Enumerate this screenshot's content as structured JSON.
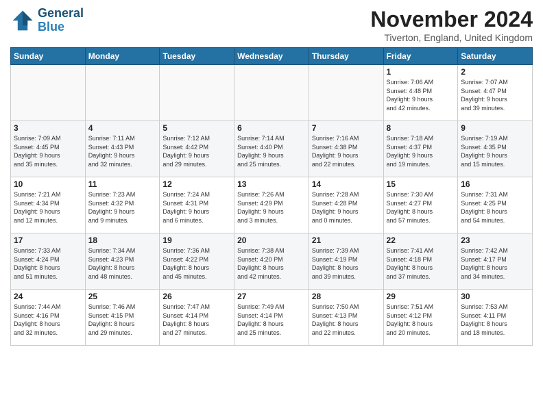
{
  "header": {
    "logo_line1": "General",
    "logo_line2": "Blue",
    "month": "November 2024",
    "location": "Tiverton, England, United Kingdom"
  },
  "weekdays": [
    "Sunday",
    "Monday",
    "Tuesday",
    "Wednesday",
    "Thursday",
    "Friday",
    "Saturday"
  ],
  "weeks": [
    [
      {
        "day": "",
        "info": ""
      },
      {
        "day": "",
        "info": ""
      },
      {
        "day": "",
        "info": ""
      },
      {
        "day": "",
        "info": ""
      },
      {
        "day": "",
        "info": ""
      },
      {
        "day": "1",
        "info": "Sunrise: 7:06 AM\nSunset: 4:48 PM\nDaylight: 9 hours\nand 42 minutes."
      },
      {
        "day": "2",
        "info": "Sunrise: 7:07 AM\nSunset: 4:47 PM\nDaylight: 9 hours\nand 39 minutes."
      }
    ],
    [
      {
        "day": "3",
        "info": "Sunrise: 7:09 AM\nSunset: 4:45 PM\nDaylight: 9 hours\nand 35 minutes."
      },
      {
        "day": "4",
        "info": "Sunrise: 7:11 AM\nSunset: 4:43 PM\nDaylight: 9 hours\nand 32 minutes."
      },
      {
        "day": "5",
        "info": "Sunrise: 7:12 AM\nSunset: 4:42 PM\nDaylight: 9 hours\nand 29 minutes."
      },
      {
        "day": "6",
        "info": "Sunrise: 7:14 AM\nSunset: 4:40 PM\nDaylight: 9 hours\nand 25 minutes."
      },
      {
        "day": "7",
        "info": "Sunrise: 7:16 AM\nSunset: 4:38 PM\nDaylight: 9 hours\nand 22 minutes."
      },
      {
        "day": "8",
        "info": "Sunrise: 7:18 AM\nSunset: 4:37 PM\nDaylight: 9 hours\nand 19 minutes."
      },
      {
        "day": "9",
        "info": "Sunrise: 7:19 AM\nSunset: 4:35 PM\nDaylight: 9 hours\nand 15 minutes."
      }
    ],
    [
      {
        "day": "10",
        "info": "Sunrise: 7:21 AM\nSunset: 4:34 PM\nDaylight: 9 hours\nand 12 minutes."
      },
      {
        "day": "11",
        "info": "Sunrise: 7:23 AM\nSunset: 4:32 PM\nDaylight: 9 hours\nand 9 minutes."
      },
      {
        "day": "12",
        "info": "Sunrise: 7:24 AM\nSunset: 4:31 PM\nDaylight: 9 hours\nand 6 minutes."
      },
      {
        "day": "13",
        "info": "Sunrise: 7:26 AM\nSunset: 4:29 PM\nDaylight: 9 hours\nand 3 minutes."
      },
      {
        "day": "14",
        "info": "Sunrise: 7:28 AM\nSunset: 4:28 PM\nDaylight: 9 hours\nand 0 minutes."
      },
      {
        "day": "15",
        "info": "Sunrise: 7:30 AM\nSunset: 4:27 PM\nDaylight: 8 hours\nand 57 minutes."
      },
      {
        "day": "16",
        "info": "Sunrise: 7:31 AM\nSunset: 4:25 PM\nDaylight: 8 hours\nand 54 minutes."
      }
    ],
    [
      {
        "day": "17",
        "info": "Sunrise: 7:33 AM\nSunset: 4:24 PM\nDaylight: 8 hours\nand 51 minutes."
      },
      {
        "day": "18",
        "info": "Sunrise: 7:34 AM\nSunset: 4:23 PM\nDaylight: 8 hours\nand 48 minutes."
      },
      {
        "day": "19",
        "info": "Sunrise: 7:36 AM\nSunset: 4:22 PM\nDaylight: 8 hours\nand 45 minutes."
      },
      {
        "day": "20",
        "info": "Sunrise: 7:38 AM\nSunset: 4:20 PM\nDaylight: 8 hours\nand 42 minutes."
      },
      {
        "day": "21",
        "info": "Sunrise: 7:39 AM\nSunset: 4:19 PM\nDaylight: 8 hours\nand 39 minutes."
      },
      {
        "day": "22",
        "info": "Sunrise: 7:41 AM\nSunset: 4:18 PM\nDaylight: 8 hours\nand 37 minutes."
      },
      {
        "day": "23",
        "info": "Sunrise: 7:42 AM\nSunset: 4:17 PM\nDaylight: 8 hours\nand 34 minutes."
      }
    ],
    [
      {
        "day": "24",
        "info": "Sunrise: 7:44 AM\nSunset: 4:16 PM\nDaylight: 8 hours\nand 32 minutes."
      },
      {
        "day": "25",
        "info": "Sunrise: 7:46 AM\nSunset: 4:15 PM\nDaylight: 8 hours\nand 29 minutes."
      },
      {
        "day": "26",
        "info": "Sunrise: 7:47 AM\nSunset: 4:14 PM\nDaylight: 8 hours\nand 27 minutes."
      },
      {
        "day": "27",
        "info": "Sunrise: 7:49 AM\nSunset: 4:14 PM\nDaylight: 8 hours\nand 25 minutes."
      },
      {
        "day": "28",
        "info": "Sunrise: 7:50 AM\nSunset: 4:13 PM\nDaylight: 8 hours\nand 22 minutes."
      },
      {
        "day": "29",
        "info": "Sunrise: 7:51 AM\nSunset: 4:12 PM\nDaylight: 8 hours\nand 20 minutes."
      },
      {
        "day": "30",
        "info": "Sunrise: 7:53 AM\nSunset: 4:11 PM\nDaylight: 8 hours\nand 18 minutes."
      }
    ]
  ]
}
